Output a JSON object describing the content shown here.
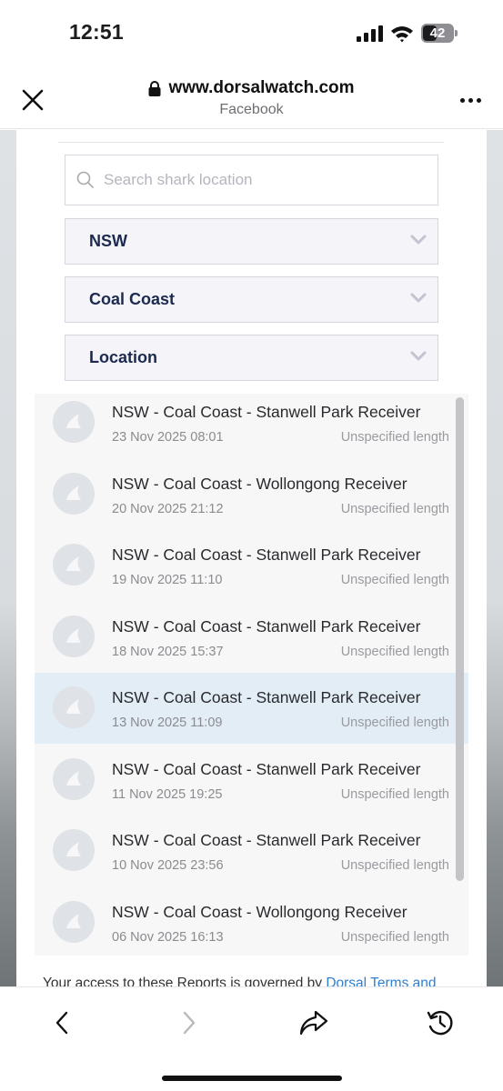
{
  "status_bar": {
    "time": "12:51",
    "battery": "42"
  },
  "browser": {
    "url": "www.dorsalwatch.com",
    "source": "Facebook"
  },
  "search": {
    "placeholder": "Search shark location"
  },
  "filters": {
    "state": "NSW",
    "region": "Coal Coast",
    "location": "Location"
  },
  "results": [
    {
      "title": "NSW - Coal Coast - Stanwell Park Receiver",
      "date": "23 Nov 2025 08:01",
      "length": "Unspecified length",
      "selected": false
    },
    {
      "title": "NSW - Coal Coast - Wollongong Receiver",
      "date": "20 Nov 2025 21:12",
      "length": "Unspecified length",
      "selected": false
    },
    {
      "title": "NSW - Coal Coast - Stanwell Park Receiver",
      "date": "19 Nov 2025 11:10",
      "length": "Unspecified length",
      "selected": false
    },
    {
      "title": "NSW - Coal Coast - Stanwell Park Receiver",
      "date": "18 Nov 2025 15:37",
      "length": "Unspecified length",
      "selected": false
    },
    {
      "title": "NSW - Coal Coast - Stanwell Park Receiver",
      "date": "13 Nov 2025 11:09",
      "length": "Unspecified length",
      "selected": true
    },
    {
      "title": "NSW - Coal Coast - Stanwell Park Receiver",
      "date": "11 Nov 2025 19:25",
      "length": "Unspecified length",
      "selected": false
    },
    {
      "title": "NSW - Coal Coast - Stanwell Park Receiver",
      "date": "10 Nov 2025 23:56",
      "length": "Unspecified length",
      "selected": false
    },
    {
      "title": "NSW - Coal Coast - Wollongong Receiver",
      "date": "06 Nov 2025 16:13",
      "length": "Unspecified length",
      "selected": false
    }
  ],
  "footer": {
    "terms_text": "Your access to these Reports is governed by ",
    "terms_link": "Dorsal Terms and"
  },
  "icons": {
    "close": "close-icon",
    "lock": "lock-icon",
    "more": "more-icon",
    "search": "search-icon",
    "chevron": "chevron-down-icon",
    "shark_fin": "shark-fin-icon",
    "back": "chevron-left-icon",
    "forward": "chevron-right-icon",
    "share": "share-icon",
    "history": "history-icon"
  },
  "colors": {
    "link": "#2f7fd1",
    "select_text": "#1b2a4e",
    "selected_row": "#e2edf6"
  }
}
